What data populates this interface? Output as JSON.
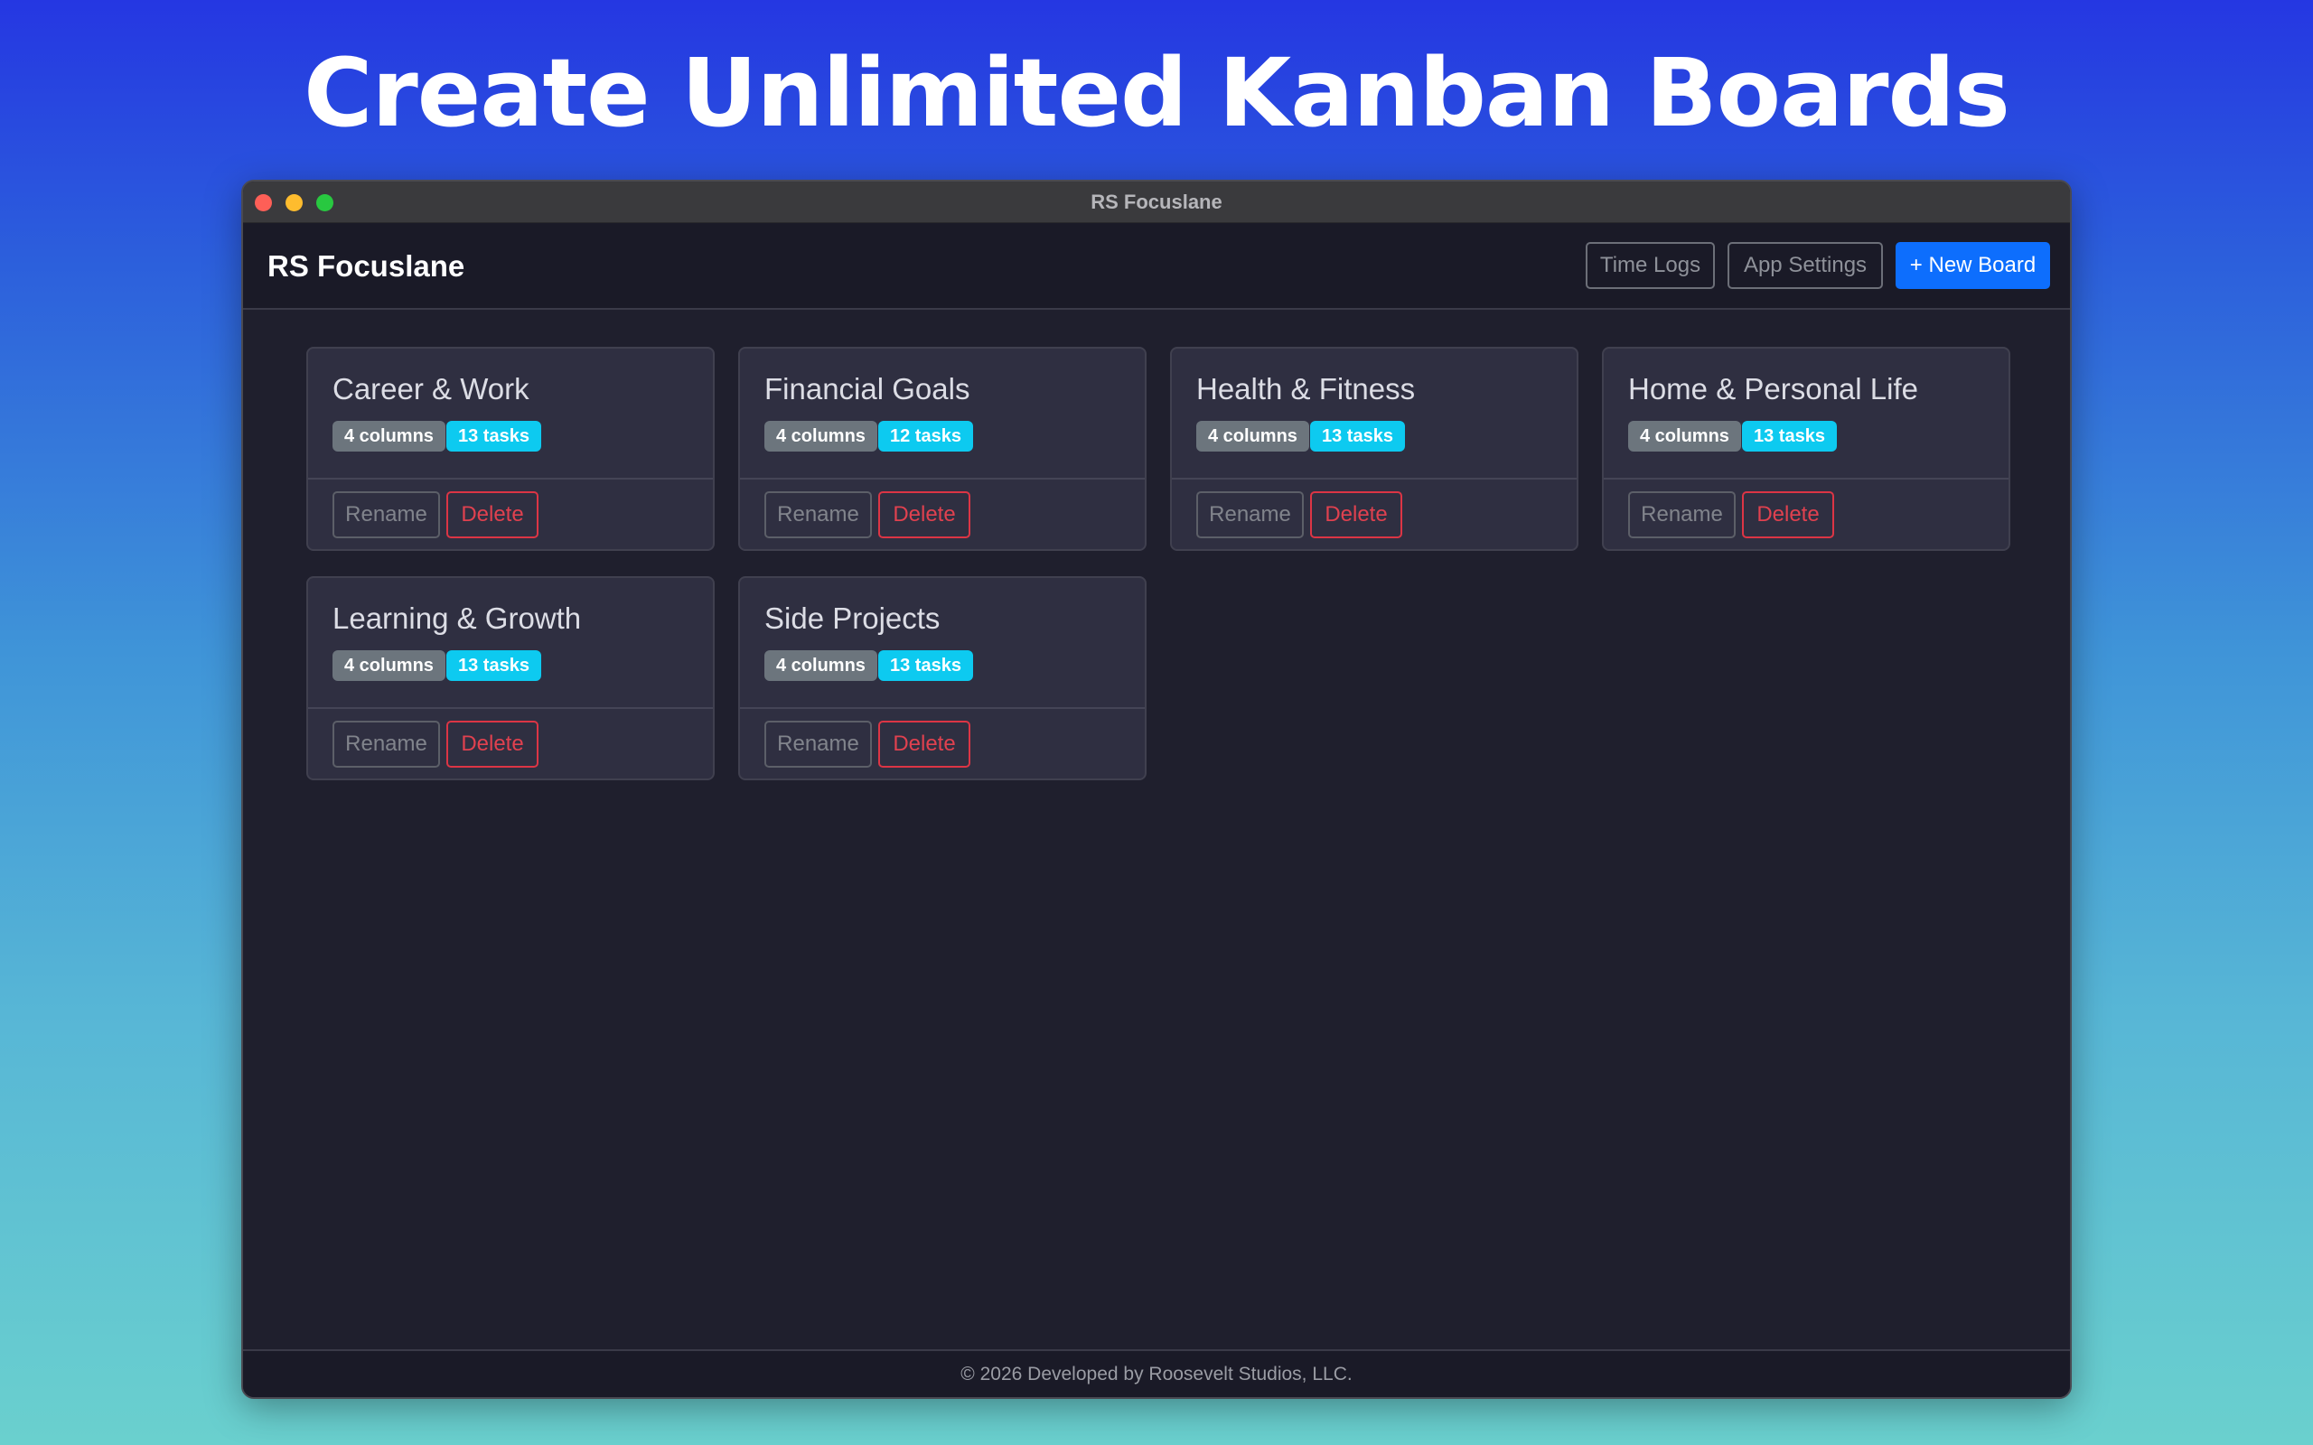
{
  "promo": {
    "headline": "Create Unlimited Kanban Boards"
  },
  "window": {
    "title": "RS Focuslane"
  },
  "header": {
    "brand": "RS Focuslane",
    "time_logs_label": "Time Logs",
    "app_settings_label": "App Settings",
    "new_board_label": "+ New Board"
  },
  "boards": [
    {
      "name": "Career & Work",
      "columns": "4 columns",
      "tasks": "13 tasks",
      "rename_label": "Rename",
      "delete_label": "Delete"
    },
    {
      "name": "Financial Goals",
      "columns": "4 columns",
      "tasks": "12 tasks",
      "rename_label": "Rename",
      "delete_label": "Delete"
    },
    {
      "name": "Health & Fitness",
      "columns": "4 columns",
      "tasks": "13 tasks",
      "rename_label": "Rename",
      "delete_label": "Delete"
    },
    {
      "name": "Home & Personal Life",
      "columns": "4 columns",
      "tasks": "13 tasks",
      "rename_label": "Rename",
      "delete_label": "Delete"
    },
    {
      "name": "Learning & Growth",
      "columns": "4 columns",
      "tasks": "13 tasks",
      "rename_label": "Rename",
      "delete_label": "Delete"
    },
    {
      "name": "Side Projects",
      "columns": "4 columns",
      "tasks": "13 tasks",
      "rename_label": "Rename",
      "delete_label": "Delete"
    }
  ],
  "footer": {
    "text": "© 2026 Developed by Roosevelt Studios, LLC."
  },
  "colors": {
    "primary": "#0d6efd",
    "danger": "#dc3545",
    "info_badge": "#0dcaf0",
    "secondary_badge": "#6c757d",
    "background": "#1f1f2d"
  }
}
